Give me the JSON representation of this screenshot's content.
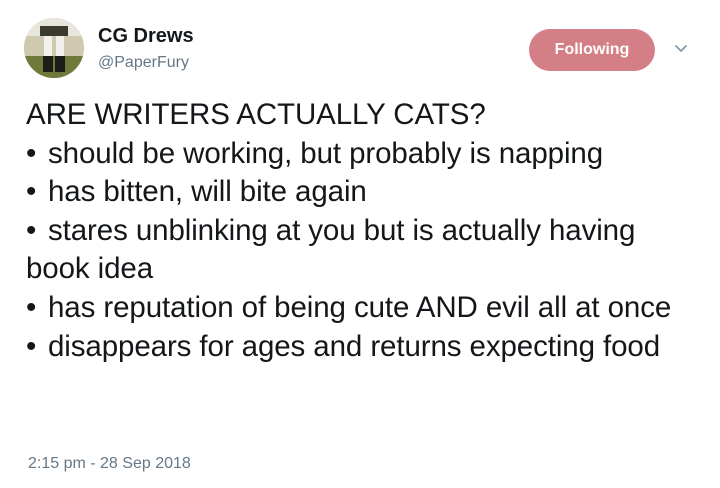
{
  "author": {
    "display_name": "CG Drews",
    "handle": "@PaperFury"
  },
  "follow_button": {
    "label": "Following",
    "color": "#d47e86"
  },
  "menu_icon": "chevron-down-icon",
  "tweet": {
    "heading": "ARE WRITERS ACTUALLY CATS?",
    "bullets": [
      "should be working, but probably is napping",
      "has bitten, will bite again",
      "stares unblinking at you but is actually having book idea",
      "has reputation of being cute AND evil all at once",
      "disappears for ages and returns expecting food"
    ],
    "bullet_symbol": "•"
  },
  "timestamp": "2:15 pm - 28 Sep 2018"
}
